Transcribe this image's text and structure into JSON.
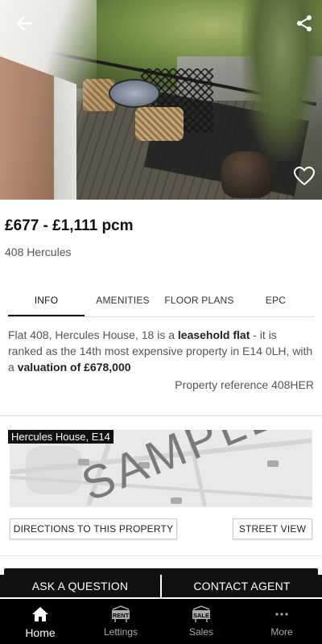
{
  "listing": {
    "price": "£677 - £1,111 pcm",
    "address": "408 Hercules"
  },
  "tabs": [
    {
      "label": "INFO",
      "active": true
    },
    {
      "label": "AMENITIES",
      "active": false
    },
    {
      "label": "FLOOR PLANS",
      "active": false
    },
    {
      "label": "EPC",
      "active": false
    }
  ],
  "info": {
    "desc_part1": "Flat 408, Hercules House, 18 is a ",
    "desc_bold1": "leasehold flat",
    "desc_part2": " - it is ranked as the 14th most expensive property in E14 0LH, with a ",
    "desc_bold2": "valuation of £678,000",
    "reference": "Property reference 408HER"
  },
  "map": {
    "label": "Hercules House, E14",
    "watermark": "SAMPLE",
    "directions_button": "DIRECTIONS TO THIS PROPERTY",
    "street_view_button": "STREET VIEW"
  },
  "actions": {
    "ask": "ASK A QUESTION",
    "contact": "CONTACT AGENT"
  },
  "bottom_nav": [
    {
      "label": "Home",
      "icon": "home-icon",
      "active": true
    },
    {
      "label": "Lettings",
      "icon": "rent-sign-icon",
      "badge": "RENT",
      "active": false
    },
    {
      "label": "Sales",
      "icon": "sale-sign-icon",
      "badge": "SALE",
      "active": false
    },
    {
      "label": "More",
      "icon": "more-dots-icon",
      "active": false
    }
  ],
  "icons": {
    "back": "back-arrow-icon",
    "share": "share-icon",
    "favorite": "heart-icon"
  },
  "colors": {
    "primary": "#111111",
    "nav_background": "#000000"
  }
}
